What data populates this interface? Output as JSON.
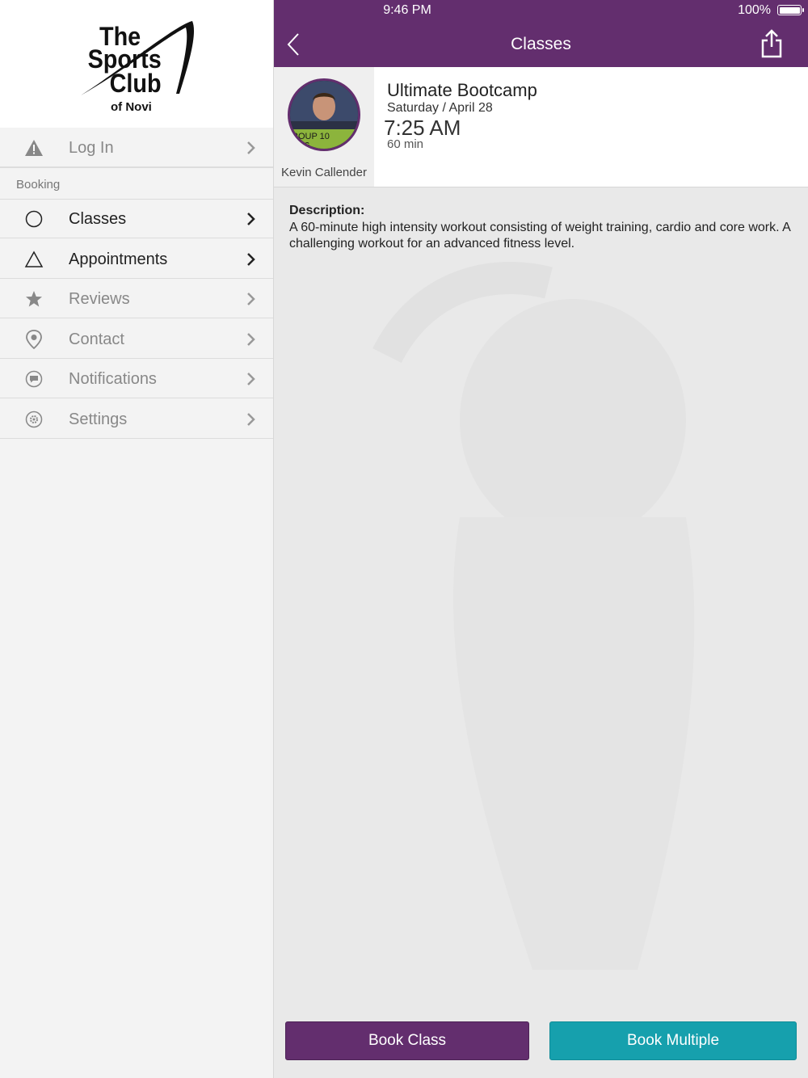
{
  "status_bar": {
    "time": "9:46 PM",
    "battery": "100%"
  },
  "colors": {
    "brand_purple": "#632e6e",
    "teal": "#16a0ad"
  },
  "logo": {
    "line1": "The",
    "line2": "Sports",
    "line3": "Club",
    "line4": "of Novi"
  },
  "sidebar": {
    "login": {
      "label": "Log In",
      "icon": "warning-icon"
    },
    "section_label": "Booking",
    "items": [
      {
        "label": "Classes",
        "icon": "circle-icon",
        "active": true
      },
      {
        "label": "Appointments",
        "icon": "triangle-icon",
        "active": true
      },
      {
        "label": "Reviews",
        "icon": "star-icon",
        "active": false
      },
      {
        "label": "Contact",
        "icon": "location-pin-icon",
        "active": false
      },
      {
        "label": "Notifications",
        "icon": "chat-bubble-icon",
        "active": false
      },
      {
        "label": "Settings",
        "icon": "gear-icon",
        "active": false
      }
    ]
  },
  "nav": {
    "title": "Classes",
    "back_icon": "chevron-left-icon",
    "share_icon": "share-icon"
  },
  "class": {
    "title": "Ultimate Bootcamp",
    "date": "Saturday / April 28",
    "time": "7:25 AM",
    "duration": "60 min",
    "instructor": "Kevin Callender",
    "avatar_text": "ROUP 10",
    "avatar_subtext": "INING"
  },
  "description": {
    "heading": "Description:",
    "body": "A 60-minute high intensity workout consisting of weight training, cardio and core work. A challenging workout for an advanced fitness level."
  },
  "buttons": {
    "book_class": "Book Class",
    "book_multiple": "Book Multiple"
  }
}
